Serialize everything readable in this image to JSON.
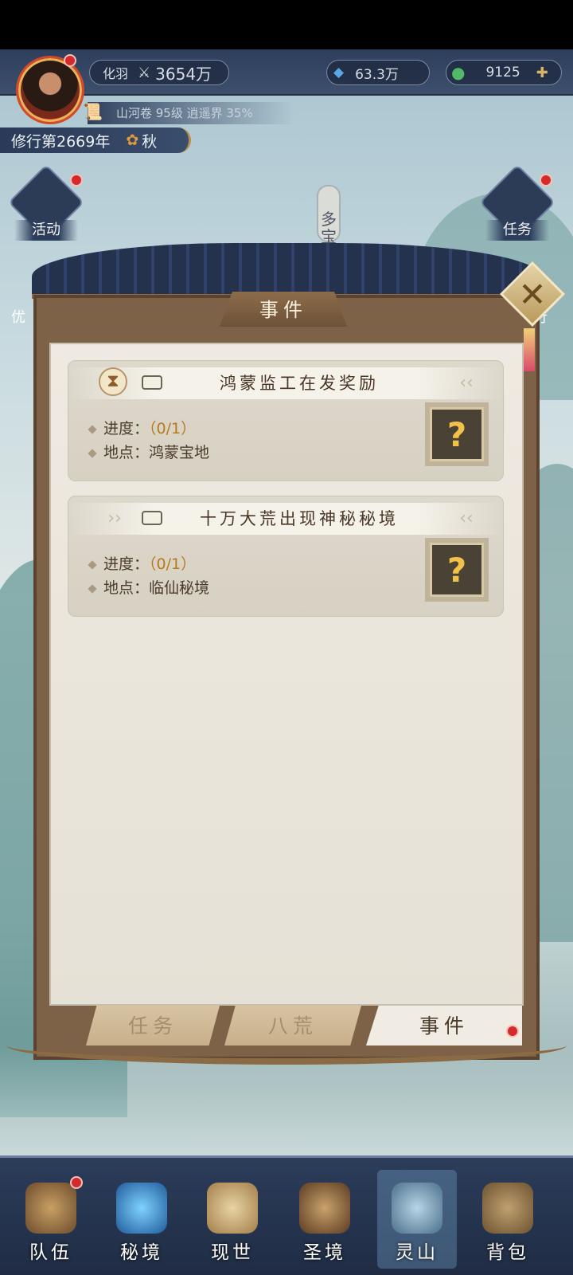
{
  "top": {
    "realm_label": "化羽",
    "power_value": "3654万",
    "crystal_value": "63.3万",
    "jade_value": "9125",
    "subline": "山河卷 95级 逍遥界 35%",
    "year_text": "修行第2669年",
    "season": "秋"
  },
  "side": {
    "activity": "活动",
    "task": "任务",
    "left_partial": "优",
    "right_partial": "行",
    "sign_text": "多宝"
  },
  "modal": {
    "title": "事件",
    "events": [
      {
        "title": "鸿蒙监工在发奖励",
        "progress_label": "进度：",
        "progress_value": "（0/1）",
        "location_label": "地点：",
        "location_value": "鸿蒙宝地"
      },
      {
        "title": "十万大荒出现神秘秘境",
        "progress_label": "进度：",
        "progress_value": "（0/1）",
        "location_label": "地点：",
        "location_value": "临仙秘境"
      }
    ],
    "tabs": [
      "任务",
      "八荒",
      "事件"
    ]
  },
  "nav": [
    "队伍",
    "秘境",
    "现世",
    "圣境",
    "灵山",
    "背包"
  ],
  "colors": {
    "accent_red": "#d32b2b",
    "progress": "#b8791e",
    "paper": "#eeeae1"
  }
}
